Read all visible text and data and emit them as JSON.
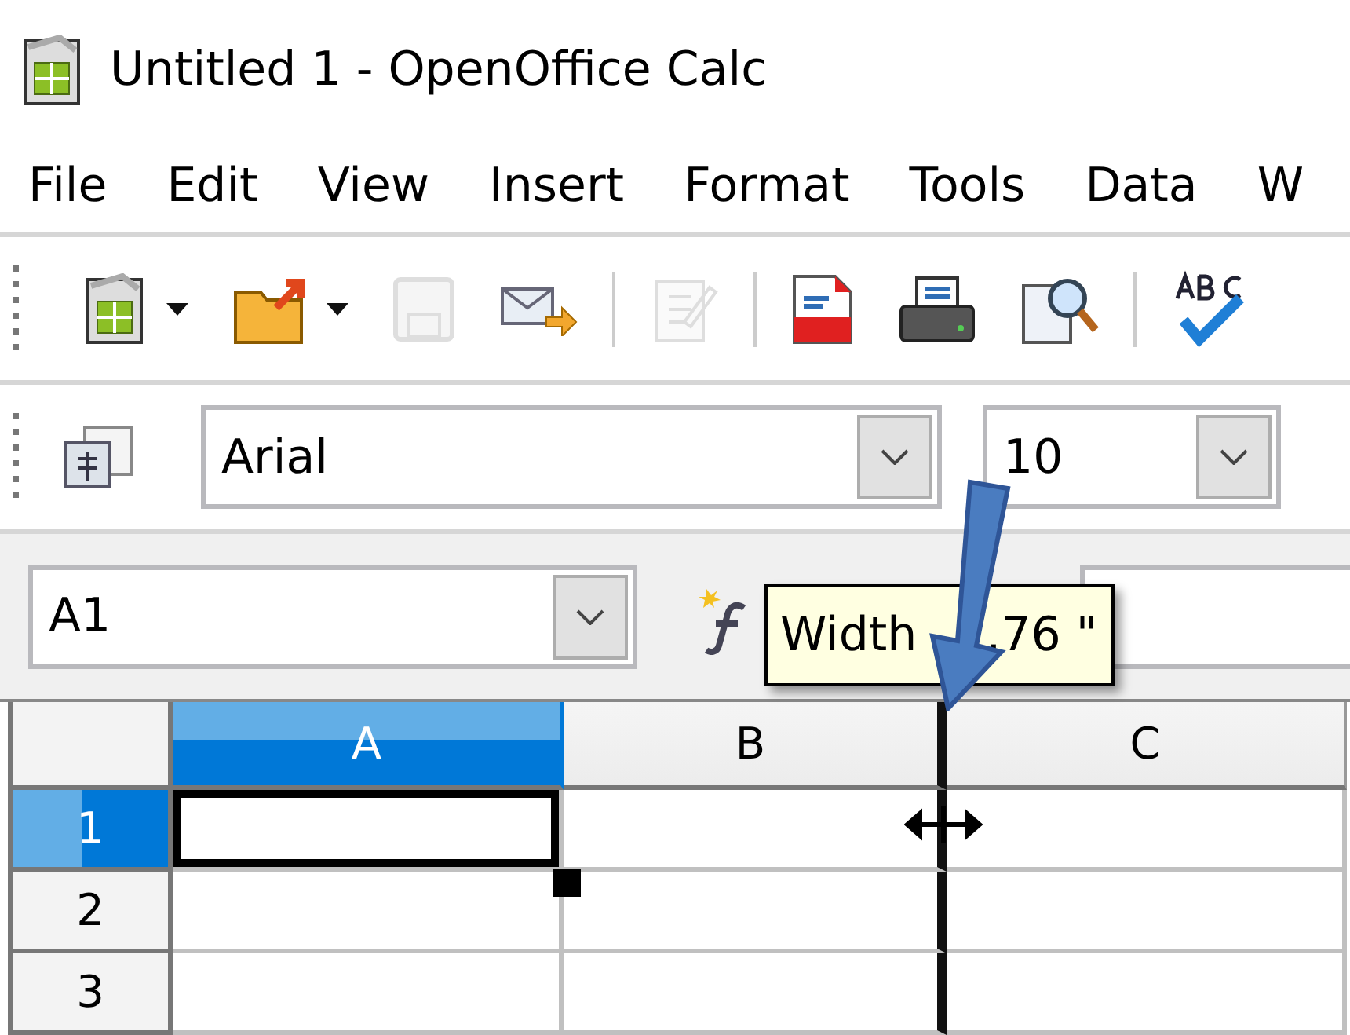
{
  "window": {
    "title": "Untitled 1 - OpenOffice Calc"
  },
  "menu": [
    "File",
    "Edit",
    "View",
    "Insert",
    "Format",
    "Tools",
    "Data",
    "W"
  ],
  "standard_toolbar": [
    {
      "kind": "new",
      "dropdown": true,
      "disabled": false
    },
    {
      "kind": "open",
      "dropdown": true,
      "disabled": false
    },
    {
      "kind": "save",
      "dropdown": false,
      "disabled": true
    },
    {
      "kind": "mail",
      "dropdown": false,
      "disabled": false
    },
    {
      "kind": "separator"
    },
    {
      "kind": "edit",
      "dropdown": false,
      "disabled": true
    },
    {
      "kind": "separator"
    },
    {
      "kind": "pdf",
      "dropdown": false,
      "disabled": false
    },
    {
      "kind": "print",
      "dropdown": false,
      "disabled": false
    },
    {
      "kind": "preview",
      "dropdown": false,
      "disabled": false
    },
    {
      "kind": "separator"
    },
    {
      "kind": "spelling",
      "dropdown": false,
      "disabled": false
    }
  ],
  "formatting_toolbar": {
    "font_name": "Arial",
    "font_size": "10"
  },
  "formula_bar": {
    "name_box": "A1",
    "tooltip": [
      "Width",
      ".76 \""
    ]
  },
  "grid": {
    "columns": [
      {
        "label": "A",
        "selected": true,
        "resizing": false
      },
      {
        "label": "B",
        "selected": false,
        "resizing": true
      },
      {
        "label": "C",
        "selected": false,
        "resizing": false
      }
    ],
    "rows": [
      {
        "label": "1",
        "selected": true
      },
      {
        "label": "2",
        "selected": false
      },
      {
        "label": "3",
        "selected": false
      }
    ]
  }
}
